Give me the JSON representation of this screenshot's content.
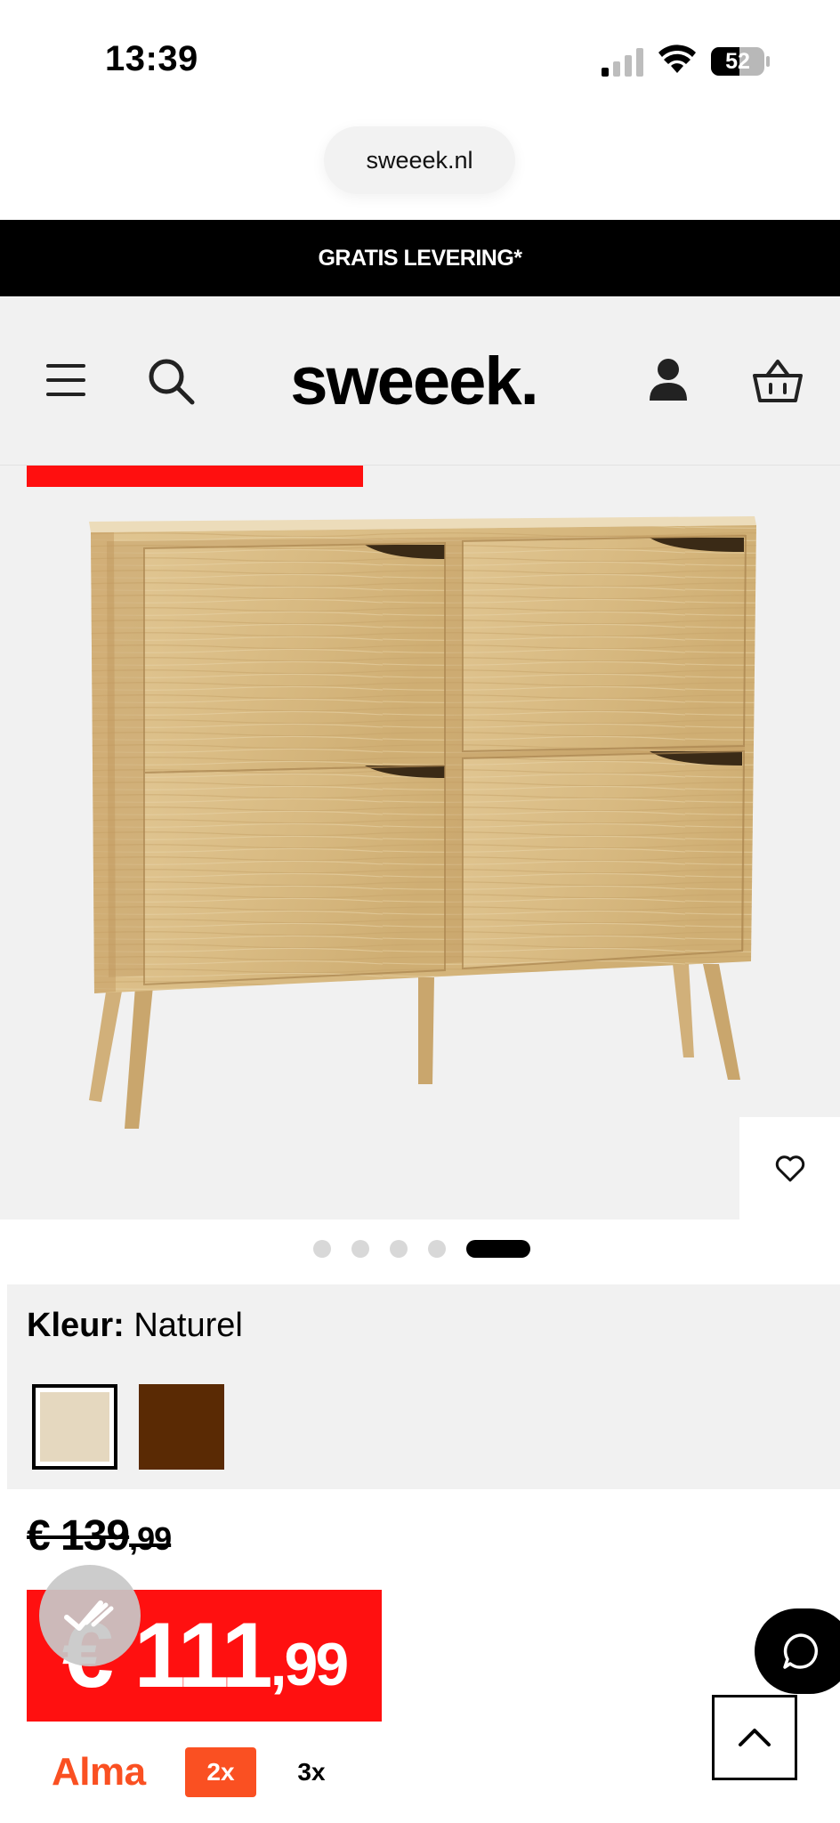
{
  "status_bar": {
    "time": "13:39",
    "battery": "52"
  },
  "browser": {
    "url": "sweeek.nl"
  },
  "promo_banner": {
    "text": "GRATIS LEVERING*"
  },
  "header": {
    "logo": "sweeek."
  },
  "gallery": {
    "slide_count": 5,
    "active_slide": 5
  },
  "color_selector": {
    "label": "Kleur:",
    "selected_value": "Naturel",
    "swatches": [
      {
        "color": "#e5d8bf",
        "selected": true
      },
      {
        "color": "#5a2a04",
        "selected": false
      }
    ]
  },
  "pricing": {
    "old_price_main": "€ 139",
    "old_price_decimals": ",99",
    "price_main": "€ 111",
    "price_decimals": ",99"
  },
  "alma": {
    "logo": "Alma",
    "option_2x": "2x",
    "option_3x": "3x"
  },
  "colors": {
    "accent_red": "#ff1010",
    "alma_orange": "#fa5022",
    "header_bg": "#f1f1f1",
    "banner_bg": "#000000"
  },
  "icons": [
    "menu-icon",
    "search-icon",
    "account-icon",
    "cart-icon",
    "heart-icon",
    "chat-icon",
    "chevron-up-icon",
    "signal-icon",
    "wifi-icon",
    "battery-icon",
    "checkmark-icon"
  ]
}
